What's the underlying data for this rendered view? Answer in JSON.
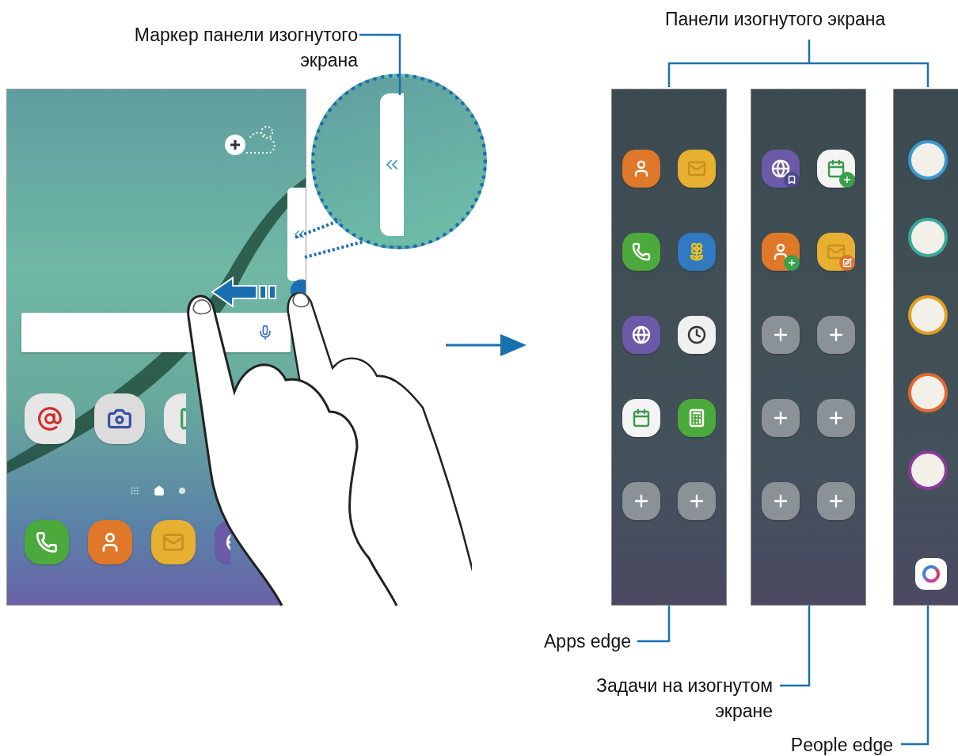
{
  "marker_callout": "Маркер панели изогнутого экрана",
  "panels_title": "Панели изогнутого экрана",
  "home_screen": {
    "apps": [
      {
        "kind": "email",
        "color": "#e6e6e6"
      },
      {
        "kind": "camera",
        "color": "#dcdcdc"
      },
      {
        "kind": "store",
        "color": "#e8e8e8"
      }
    ],
    "dock": [
      {
        "kind": "phone",
        "color": "#4caa3c"
      },
      {
        "kind": "contact",
        "color": "#e0782a"
      },
      {
        "kind": "message",
        "color": "#e8b030"
      },
      {
        "kind": "globe",
        "color": "#6a5aa8"
      }
    ]
  },
  "apps_edge": {
    "label": "Apps edge",
    "items": [
      {
        "kind": "contact",
        "color": "#e0782a"
      },
      {
        "kind": "message",
        "color": "#e8b030"
      },
      {
        "kind": "phone",
        "color": "#4caa3c"
      },
      {
        "kind": "gallery",
        "color": "#2f7ac0"
      },
      {
        "kind": "globe",
        "color": "#6a5aa8"
      },
      {
        "kind": "clock",
        "color": "#f0f0f0"
      },
      {
        "kind": "calendar",
        "color": "#f4f4f4"
      },
      {
        "kind": "calculator",
        "color": "#4caa3c"
      },
      {
        "kind": "add",
        "color": "#8a9298"
      },
      {
        "kind": "add",
        "color": "#8a9298"
      }
    ]
  },
  "tasks_edge": {
    "label": "Задачи на изогнутом экране",
    "items": [
      {
        "kind": "globe",
        "badge": {
          "kind": "bookmark"
        },
        "color": "#6a5aa8"
      },
      {
        "kind": "calendar",
        "badge": {
          "kind": "plus"
        },
        "color": "#f4f4f4"
      },
      {
        "kind": "contact",
        "badge": {
          "kind": "plus"
        },
        "color": "#e0782a"
      },
      {
        "kind": "message",
        "badge": {
          "kind": "edit"
        },
        "color": "#e8b030"
      },
      {
        "kind": "add",
        "color": "#8a9298"
      },
      {
        "kind": "add",
        "color": "#8a9298"
      },
      {
        "kind": "add",
        "color": "#8a9298"
      },
      {
        "kind": "add",
        "color": "#8a9298"
      },
      {
        "kind": "add",
        "color": "#8a9298"
      },
      {
        "kind": "add",
        "color": "#8a9298"
      }
    ]
  },
  "people_edge": {
    "label": "People edge",
    "contacts": [
      {
        "color": "#3a9ad0"
      },
      {
        "color": "#3aa89a"
      },
      {
        "color": "#e0a020"
      },
      {
        "color": "#e06a30"
      },
      {
        "color": "#8a3a9a"
      }
    ]
  }
}
